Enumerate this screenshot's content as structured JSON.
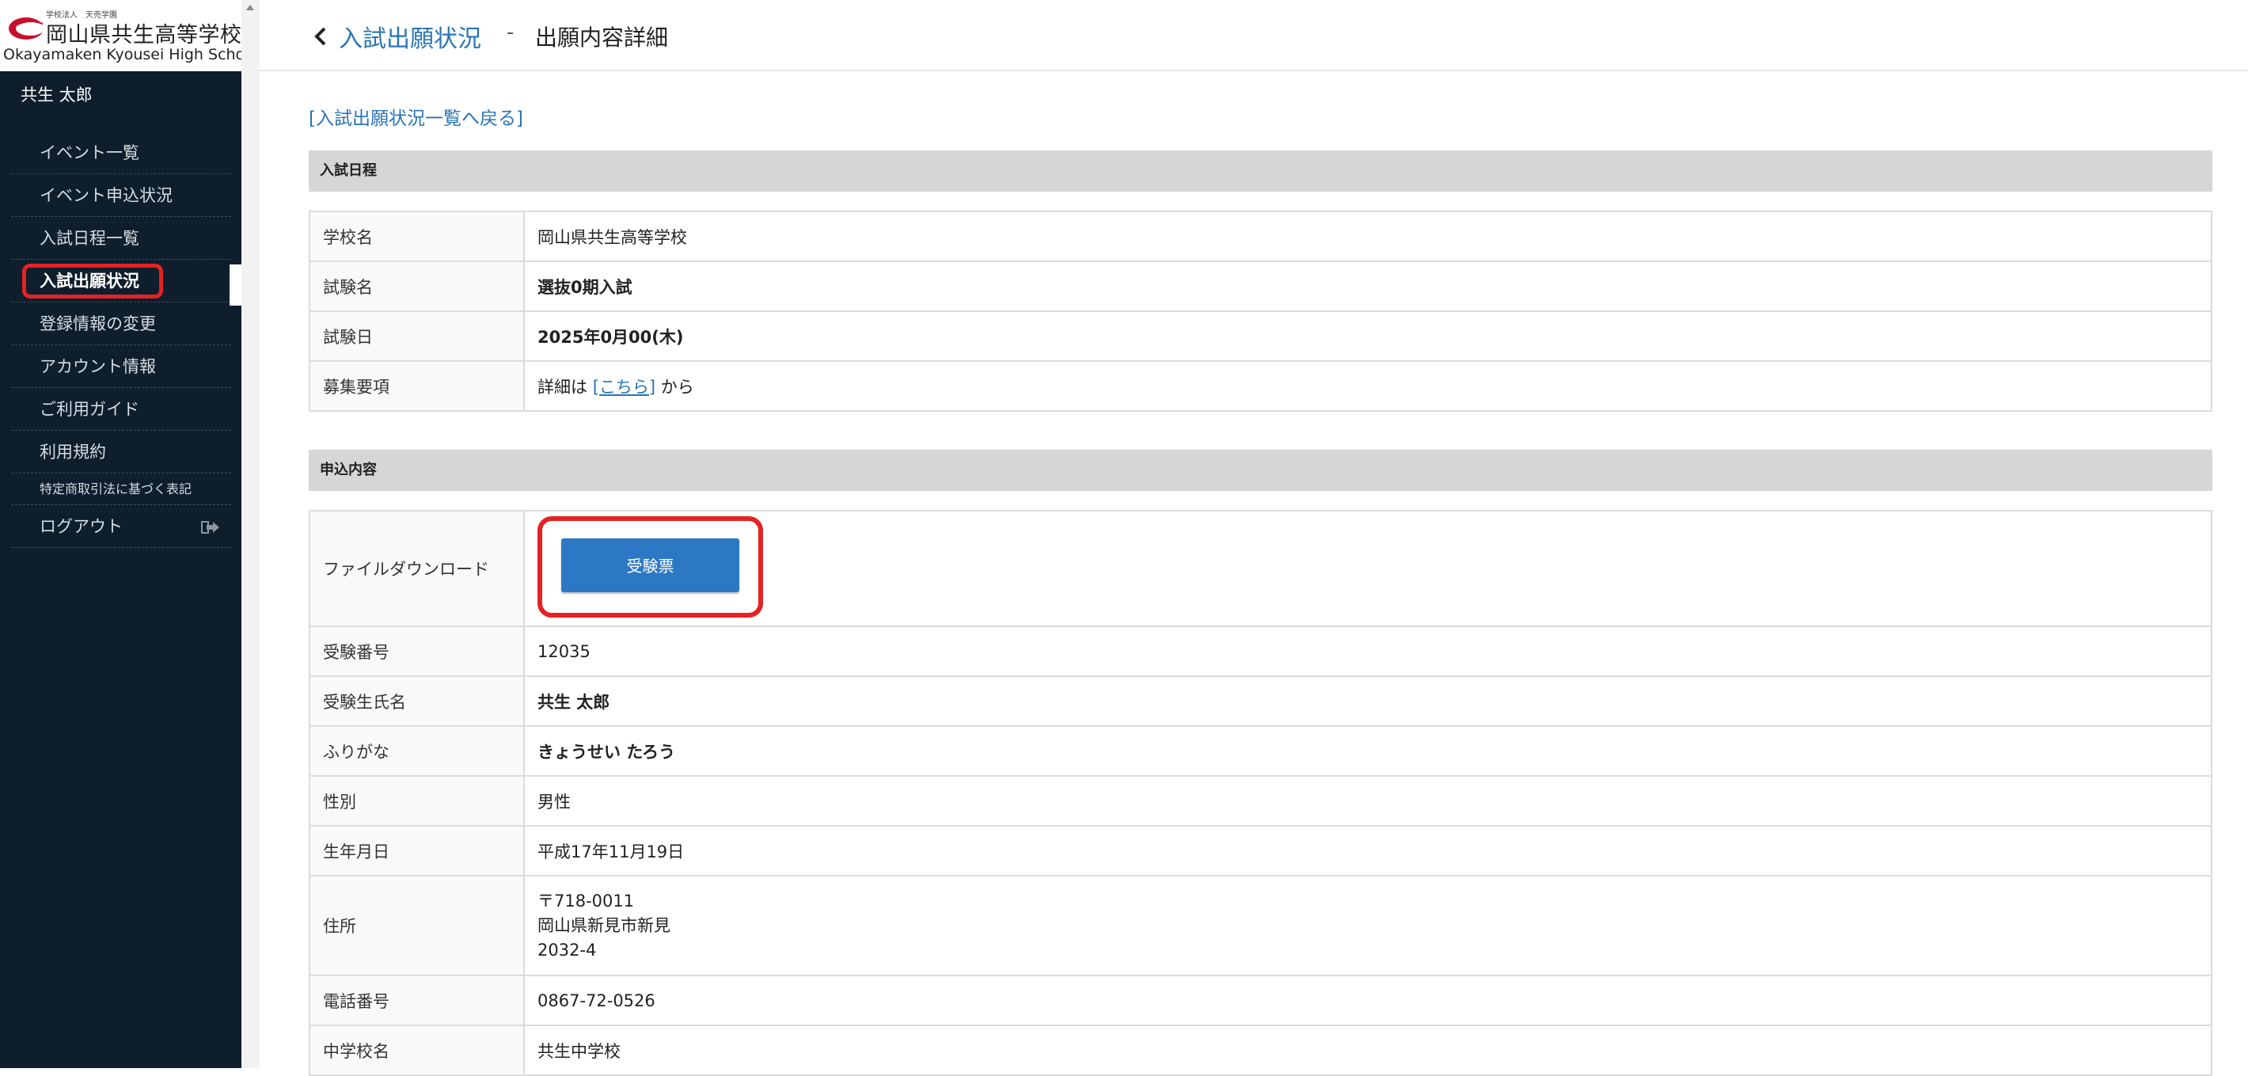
{
  "logo": {
    "small_text": "学校法人　天売学園",
    "name_jp": "岡山県共生高等学校",
    "name_en": "Okayamaken Kyousei High School",
    "brand_color": "#c8102e"
  },
  "sidebar": {
    "user_name": "共生 太郎",
    "items": [
      {
        "label": "イベント一覧"
      },
      {
        "label": "イベント申込状況"
      },
      {
        "label": "入試日程一覧"
      },
      {
        "label": "入試出願状況",
        "active": true
      },
      {
        "label": "登録情報の変更"
      },
      {
        "label": "アカウント情報"
      },
      {
        "label": "ご利用ガイド"
      },
      {
        "label": "利用規約"
      },
      {
        "label": "特定商取引法に基づく表記"
      },
      {
        "label": "ログアウト",
        "icon": "logout-icon"
      }
    ]
  },
  "header": {
    "back_icon": "chevron-left-icon",
    "breadcrumb_link": "入試出願状況",
    "separator": "-",
    "current": "出願内容詳細"
  },
  "main": {
    "back_link": "[入試出願状況一覧へ戻る]",
    "schedule": {
      "title": "入試日程",
      "rows": [
        {
          "label": "学校名",
          "value": "岡山県共生高等学校"
        },
        {
          "label": "試験名",
          "value": "選抜0期入試"
        },
        {
          "label": "試験日",
          "value": "2025年0月00(木)"
        },
        {
          "label": "募集要項",
          "prefix": "詳細は",
          "link": "[こちら]",
          "suffix": "から"
        }
      ]
    },
    "application": {
      "title": "申込内容",
      "download_label": "ファイルダウンロード",
      "download_button": "受験票",
      "rows": [
        {
          "label": "受験番号",
          "value": "12035"
        },
        {
          "label": "受験生氏名",
          "value": "共生 太郎"
        },
        {
          "label": "ふりがな",
          "value": "きょうせい たろう"
        },
        {
          "label": "性別",
          "value": "男性"
        },
        {
          "label": "生年月日",
          "value": "平成17年11月19日"
        },
        {
          "label": "住所",
          "postal": "〒718-0011",
          "line1": "岡山県新見市新見",
          "line2": "2032-4"
        },
        {
          "label": "電話番号",
          "value": "0867-72-0526"
        },
        {
          "label": "中学校名",
          "value": "共生中学校"
        }
      ]
    }
  },
  "colors": {
    "sidebar_bg": "#0f1e2c",
    "link": "#2a74b5",
    "button": "#2d78c4",
    "highlight": "#e52222",
    "section_bg": "#d6d6d6"
  }
}
